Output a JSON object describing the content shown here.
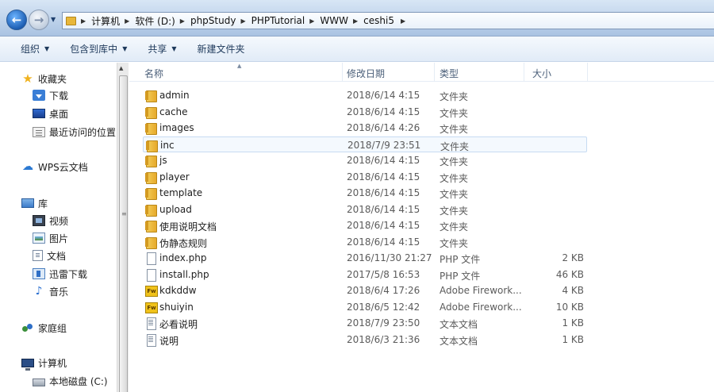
{
  "breadcrumb": [
    "计算机",
    "软件 (D:)",
    "phpStudy",
    "PHPTutorial",
    "WWW",
    "ceshi5"
  ],
  "toolbar": {
    "organize": "组织",
    "include_library": "包含到库中",
    "share": "共享",
    "new_folder": "新建文件夹"
  },
  "sidebar": {
    "favorites": "收藏夹",
    "downloads": "下载",
    "desktop": "桌面",
    "recent": "最近访问的位置",
    "wps_cloud": "WPS云文档",
    "library": "库",
    "videos": "视频",
    "pictures": "图片",
    "documents": "文档",
    "thunder": "迅雷下载",
    "music": "音乐",
    "homegroup": "家庭组",
    "computer": "计算机",
    "local_disk": "本地磁盘 (C:)"
  },
  "columns": {
    "name": "名称",
    "date": "修改日期",
    "type": "类型",
    "size": "大小"
  },
  "files": [
    {
      "name": "admin",
      "date": "2018/6/14 4:15",
      "type": "文件夹",
      "size": "",
      "icon": "folder"
    },
    {
      "name": "cache",
      "date": "2018/6/14 4:15",
      "type": "文件夹",
      "size": "",
      "icon": "folder"
    },
    {
      "name": "images",
      "date": "2018/6/14 4:26",
      "type": "文件夹",
      "size": "",
      "icon": "folder"
    },
    {
      "name": "inc",
      "date": "2018/7/9 23:51",
      "type": "文件夹",
      "size": "",
      "icon": "folder",
      "selected": true
    },
    {
      "name": "js",
      "date": "2018/6/14 4:15",
      "type": "文件夹",
      "size": "",
      "icon": "folder"
    },
    {
      "name": "player",
      "date": "2018/6/14 4:15",
      "type": "文件夹",
      "size": "",
      "icon": "folder"
    },
    {
      "name": "template",
      "date": "2018/6/14 4:15",
      "type": "文件夹",
      "size": "",
      "icon": "folder"
    },
    {
      "name": "upload",
      "date": "2018/6/14 4:15",
      "type": "文件夹",
      "size": "",
      "icon": "folder"
    },
    {
      "name": "使用说明文档",
      "date": "2018/6/14 4:15",
      "type": "文件夹",
      "size": "",
      "icon": "folder"
    },
    {
      "name": "伪静态规则",
      "date": "2018/6/14 4:15",
      "type": "文件夹",
      "size": "",
      "icon": "folder"
    },
    {
      "name": "index.php",
      "date": "2016/11/30 21:27",
      "type": "PHP 文件",
      "size": "2 KB",
      "icon": "file"
    },
    {
      "name": "install.php",
      "date": "2017/5/8 16:53",
      "type": "PHP 文件",
      "size": "46 KB",
      "icon": "file"
    },
    {
      "name": "kdkddw",
      "date": "2018/6/4 17:26",
      "type": "Adobe Firework...",
      "size": "4 KB",
      "icon": "fw"
    },
    {
      "name": "shuiyin",
      "date": "2018/6/5 12:42",
      "type": "Adobe Firework...",
      "size": "10 KB",
      "icon": "fw"
    },
    {
      "name": "必看说明",
      "date": "2018/7/9 23:50",
      "type": "文本文档",
      "size": "1 KB",
      "icon": "text"
    },
    {
      "name": "说明",
      "date": "2018/6/3 21:36",
      "type": "文本文档",
      "size": "1 KB",
      "icon": "text"
    }
  ]
}
